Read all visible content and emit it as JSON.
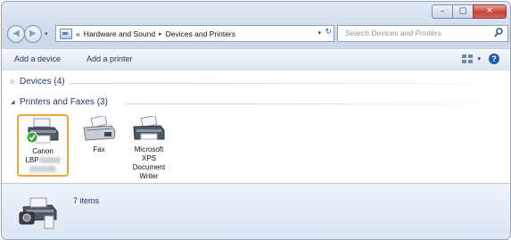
{
  "address": {
    "overflow": "«",
    "crumbs": [
      "Hardware and Sound",
      "Devices and Printers"
    ]
  },
  "search": {
    "placeholder": "Search Devices and Printers"
  },
  "commands": {
    "add_device": "Add a device",
    "add_printer": "Add a printer"
  },
  "groups": [
    {
      "label": "Devices (4)",
      "expanded": false
    },
    {
      "label": "Printers and Faxes (3)",
      "expanded": true
    }
  ],
  "devices": [
    {
      "line1": "Canon",
      "line2": "LBP",
      "selected": true,
      "default": true,
      "icon": "printer-icon"
    },
    {
      "line1": "Fax",
      "icon": "fax-icon"
    },
    {
      "line1": "Microsoft",
      "line2": "XPS",
      "line3": "Document",
      "line4": "Writer",
      "icon": "printer-icon"
    }
  ],
  "details": {
    "count_text": "7 items"
  },
  "colors": {
    "selection": "#f2a33a",
    "default_check": "#3aa534",
    "help": "#215aa8",
    "close": "#c5413a"
  }
}
